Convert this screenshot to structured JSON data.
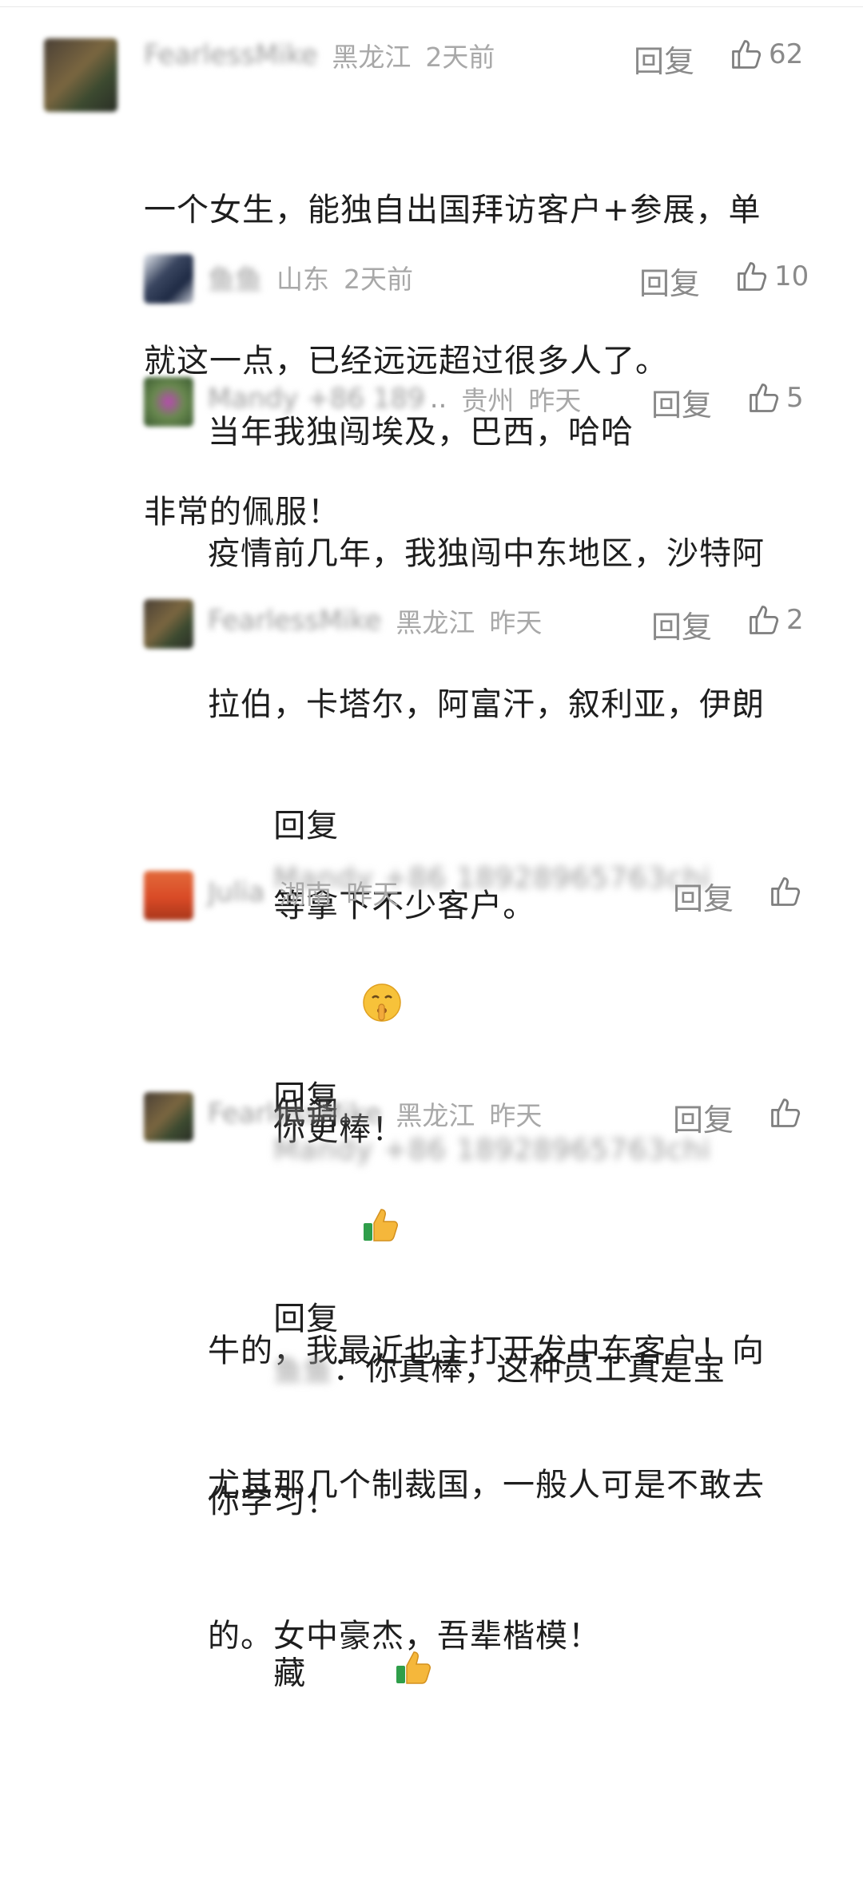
{
  "comments": [
    {
      "name": "FearlessMike",
      "location": "黑龙江",
      "time": "2天前",
      "reply_label": "回复",
      "likes": "62",
      "lines": [
        "一个女生，能独自出国拜访客户+参展，单",
        "就这一点，已经远远超过很多人了。",
        "非常的佩服！"
      ]
    },
    {
      "name": "鱼鱼",
      "location": "山东",
      "time": "2天前",
      "reply_label": "回复",
      "likes": "10",
      "lines": [
        "当年我独闯埃及，巴西，哈哈"
      ]
    },
    {
      "name": "Mandy +86 189",
      "name_ellipsis": "..",
      "location": "贵州",
      "time": "昨天",
      "reply_label": "回复",
      "likes": "5",
      "lines": [
        "疫情前几年，我独闯中东地区，沙特阿",
        "拉伯，卡塔尔，阿富汗，叙利亚，伊朗",
        "等拿下不少客户。",
        "低调。"
      ]
    },
    {
      "name": "FearlessMike",
      "location": "黑龙江",
      "time": "昨天",
      "reply_label": "回复",
      "likes": "2",
      "reply_prefix": "回复",
      "reply_target": "Mandy +86 18928965763chi",
      "lines": [
        "你更棒！",
        "尤其那几个制裁国，一般人可是不敢去",
        "的。女中豪杰，吾辈楷模！"
      ]
    },
    {
      "name": "Julia",
      "location": "湖南",
      "time": "昨天",
      "reply_label": "回复",
      "likes": "",
      "reply_prefix": "回复",
      "reply_target": "Mandy +86 18928965763chi",
      "lines": [
        "牛的，我最近也主打开发中东客户！向",
        "你学习！"
      ]
    },
    {
      "name": "FearlessMike",
      "location": "黑龙江",
      "time": "昨天",
      "reply_label": "回复",
      "likes": "",
      "reply_prefix": "回复",
      "reply_target": "鱼鱼",
      "reply_colon": "：",
      "lines": [
        "你真棒，这种员工真是宝",
        "藏"
      ]
    }
  ],
  "icons": {
    "like": "thumbs-up-outline-icon",
    "shush": "shushing-face-emoji-icon",
    "thumbs": "thumbs-up-emoji-icon"
  }
}
